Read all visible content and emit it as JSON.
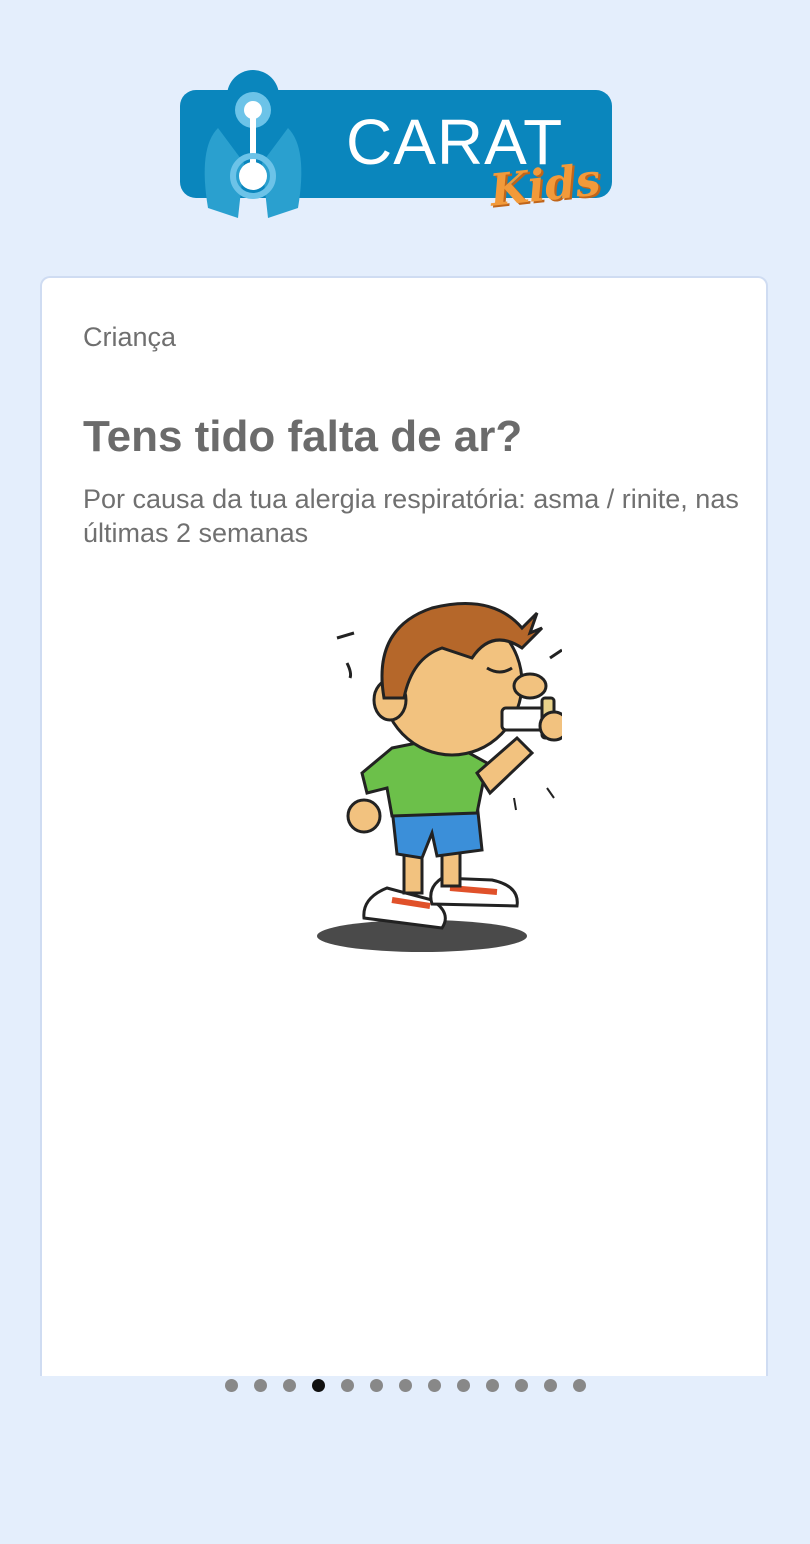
{
  "logo": {
    "wordmark": "CARAT",
    "sub": "Kids",
    "brand_color": "#0a86bd",
    "kids_color": "#f29a3a"
  },
  "card": {
    "category": "Criança",
    "question": "Tens tido falta de ar?",
    "subtitle": "Por causa da tua alergia respiratória: asma / rinite, nas últimas 2 semanas",
    "illustration_icon": "child-using-inhaler-illustration"
  },
  "pager": {
    "count": 13,
    "active_index": 3
  }
}
